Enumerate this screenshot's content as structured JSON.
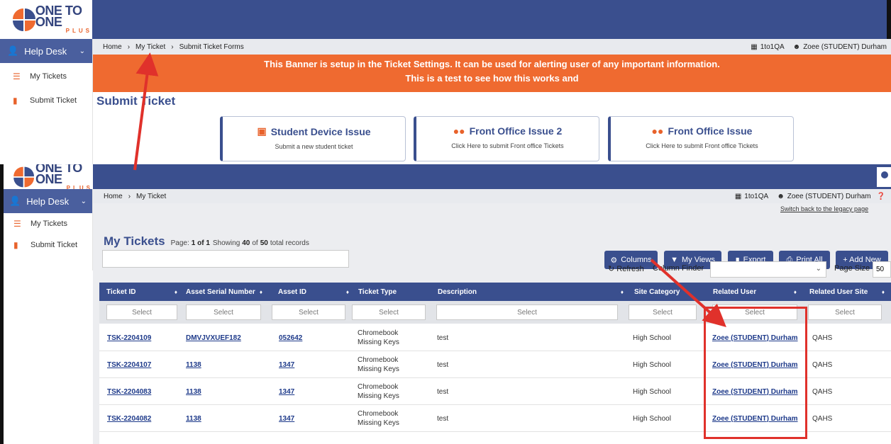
{
  "brand": {
    "name": "ONE TO ONE",
    "sub": "PLUS"
  },
  "sidebar": {
    "section": "Help Desk",
    "items": [
      {
        "label": "My Tickets"
      },
      {
        "label": "Submit Ticket"
      }
    ]
  },
  "shot1": {
    "breadcrumb": [
      "Home",
      "My Ticket",
      "Submit Ticket Forms"
    ],
    "site": "1to1QA",
    "user": "Zoee (STUDENT) Durham",
    "banner_line1": "This Banner is setup in the Ticket Settings.  It can be used for alerting user of any important information.",
    "banner_line2": "This is a test to see how this works and",
    "page_title": "Submit Ticket",
    "cards": [
      {
        "title": "Student Device Issue",
        "subtitle": "Submit a new student ticket"
      },
      {
        "title": "Front Office Issue 2",
        "subtitle": "Click Here to submit Front office Tickets"
      },
      {
        "title": "Front Office Issue",
        "subtitle": "Click Here to submit Front office Tickets"
      }
    ]
  },
  "shot2": {
    "breadcrumb": [
      "Home",
      "My Ticket"
    ],
    "site": "1to1QA",
    "user": "Zoee (STUDENT) Durham",
    "legacy_link": "Switch back to the legacy page",
    "title": "My Tickets",
    "page_label": "Page:",
    "page_value": "1 of 1",
    "showing_label": "Showing",
    "showing_count": "40",
    "showing_of": "of",
    "showing_total": "50",
    "showing_suffix": "total records",
    "buttons": {
      "columns": "Columns",
      "my_views": "My Views",
      "export": "Export",
      "print_all": "Print All",
      "add_new": "+ Add New"
    },
    "refresh": "Refresh",
    "column_finder": "Column Finder",
    "page_size_label": "Page Size",
    "page_size_value": "50",
    "filter_placeholder": "Select",
    "columns": [
      "Ticket ID",
      "Asset Serial Number",
      "Asset ID",
      "Ticket Type",
      "Description",
      "Site Category",
      "Related User",
      "Related User Site"
    ],
    "rows": [
      {
        "ticket_id": "TSK-2204109",
        "serial": "DMVJVXUEF182",
        "asset_id": "052642",
        "type1": "Chromebook",
        "type2": "Missing Keys",
        "description": "test",
        "site_category": "High School",
        "related_user": "Zoee (STUDENT) Durham",
        "user_site": "QAHS"
      },
      {
        "ticket_id": "TSK-2204107",
        "serial": "1138",
        "asset_id": "1347",
        "type1": "Chromebook",
        "type2": "Missing Keys",
        "description": "test",
        "site_category": "High School",
        "related_user": "Zoee (STUDENT) Durham",
        "user_site": "QAHS"
      },
      {
        "ticket_id": "TSK-2204083",
        "serial": "1138",
        "asset_id": "1347",
        "type1": "Chromebook",
        "type2": "Missing Keys",
        "description": "test",
        "site_category": "High School",
        "related_user": "Zoee (STUDENT) Durham",
        "user_site": "QAHS"
      },
      {
        "ticket_id": "TSK-2204082",
        "serial": "1138",
        "asset_id": "1347",
        "type1": "Chromebook",
        "type2": "Missing Keys",
        "description": "test",
        "site_category": "High School",
        "related_user": "Zoee (STUDENT) Durham",
        "user_site": "QAHS"
      }
    ]
  },
  "colors": {
    "navy": "#3a4f8e",
    "orange": "#ef6a30",
    "annotation_red": "#e0312b"
  }
}
